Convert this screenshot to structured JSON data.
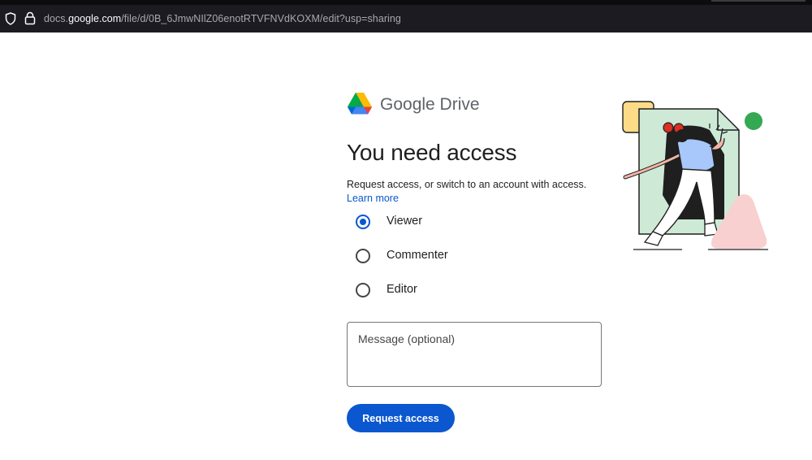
{
  "browser": {
    "url_prefix": "docs.",
    "url_host": "google.com",
    "url_path": "/file/d/0B_6JmwNIlZ06enotRTVFNVdKOXM/edit?usp=sharing",
    "icons": [
      "shield-icon",
      "lock-icon"
    ]
  },
  "logo": {
    "text": "Google Drive",
    "icon": "google-drive-icon"
  },
  "page": {
    "title": "You need access",
    "description": "Request access, or switch to an account with access.",
    "learn_more": "Learn more"
  },
  "access_options": [
    {
      "label": "Viewer",
      "selected": true
    },
    {
      "label": "Commenter",
      "selected": false
    },
    {
      "label": "Editor",
      "selected": false
    }
  ],
  "message": {
    "placeholder": "Message (optional)",
    "value": ""
  },
  "request_button": {
    "label": "Request access"
  },
  "colors": {
    "accent": "#0b57d0",
    "text": "#1f1f1f",
    "browser_bar": "#1c1b22",
    "illustration_green": "#ceead6",
    "illustration_dot": "#34a853",
    "illustration_yellow": "#fddb87",
    "illustration_pink": "#f8d0cf"
  }
}
